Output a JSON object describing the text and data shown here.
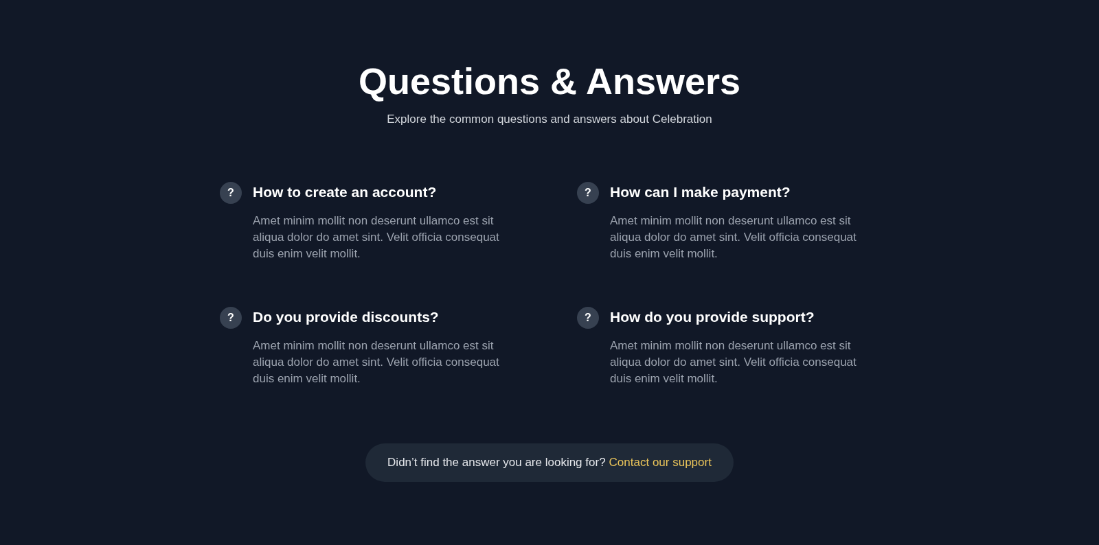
{
  "header": {
    "title": "Questions & Answers",
    "subtitle": "Explore the common questions and answers about Celebration"
  },
  "faqs": [
    {
      "icon": "?",
      "question": "How to create an account?",
      "answer": "Amet minim mollit non deserunt ullamco est sit aliqua dolor do amet sint. Velit officia consequat duis enim velit mollit."
    },
    {
      "icon": "?",
      "question": "How can I make payment?",
      "answer": "Amet minim mollit non deserunt ullamco est sit aliqua dolor do amet sint. Velit officia consequat duis enim velit mollit."
    },
    {
      "icon": "?",
      "question": "Do you provide discounts?",
      "answer": "Amet minim mollit non deserunt ullamco est sit aliqua dolor do amet sint. Velit officia consequat duis enim velit mollit."
    },
    {
      "icon": "?",
      "question": "How do you provide support?",
      "answer": "Amet minim mollit non deserunt ullamco est sit aliqua dolor do amet sint. Velit officia consequat duis enim velit mollit."
    }
  ],
  "support_banner": {
    "text": "Didn’t find the answer you are looking for?",
    "link": "Contact our support"
  }
}
